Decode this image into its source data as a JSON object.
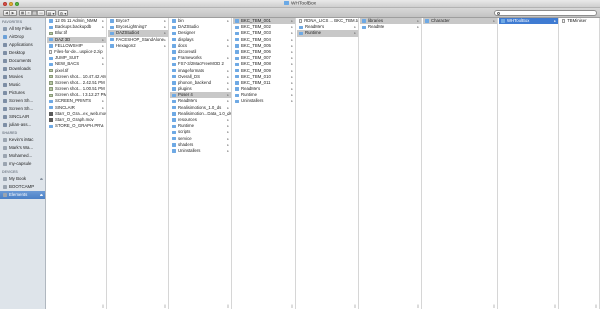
{
  "window": {
    "title": "WHToolBox"
  },
  "toolbar": {
    "back_label": "◀",
    "forward_label": "▶",
    "view_modes": [
      "▦",
      "≡",
      "▥",
      "▭"
    ],
    "arrange_label": "▤ ▾",
    "action_label": "⚙ ▾",
    "search_placeholder": ""
  },
  "sidebar": {
    "favorites_heading": "FAVORITES",
    "favorites": [
      {
        "label": "All My Files",
        "icon": "all-files-icon",
        "color": "#8a9bb0"
      },
      {
        "label": "AirDrop",
        "icon": "airdrop-icon",
        "color": "#6aa0d8"
      },
      {
        "label": "Applications",
        "icon": "applications-icon",
        "color": "#7d8ea5"
      },
      {
        "label": "Desktop",
        "icon": "desktop-icon",
        "color": "#7d8ea5"
      },
      {
        "label": "Documents",
        "icon": "documents-icon",
        "color": "#7d8ea5"
      },
      {
        "label": "Downloads",
        "icon": "downloads-icon",
        "color": "#7d8ea5"
      },
      {
        "label": "Movies",
        "icon": "movies-icon",
        "color": "#7d8ea5"
      },
      {
        "label": "Music",
        "icon": "music-icon",
        "color": "#7d8ea5"
      },
      {
        "label": "Pictures",
        "icon": "pictures-icon",
        "color": "#7d8ea5"
      },
      {
        "label": "Screen Sh...",
        "icon": "folder-icon",
        "color": "#7d8ea5"
      },
      {
        "label": "Screen Sh...",
        "icon": "folder-icon",
        "color": "#7d8ea5"
      },
      {
        "label": "SINCLAIR",
        "icon": "folder-icon",
        "color": "#7d8ea5"
      },
      {
        "label": "julian-ass...",
        "icon": "folder-icon",
        "color": "#7d8ea5"
      }
    ],
    "shared_heading": "SHARED",
    "shared": [
      {
        "label": "Kevin's iMac",
        "icon": "imac-icon",
        "color": "#9aa4b0"
      },
      {
        "label": "Mark's Wa...",
        "icon": "computer-icon",
        "color": "#9aa4b0"
      },
      {
        "label": "Mohamed...",
        "icon": "computer-icon",
        "color": "#9aa4b0"
      },
      {
        "label": "my-capsule",
        "icon": "time-capsule-icon",
        "color": "#9aa4b0"
      }
    ],
    "devices_heading": "DEVICES",
    "devices": [
      {
        "label": "My Book",
        "icon": "external-drive-icon",
        "color": "#9aa4b0",
        "eject": "⏏",
        "selected": false
      },
      {
        "label": "BOOTCAMP",
        "icon": "internal-drive-icon",
        "color": "#9aa4b0",
        "eject": "",
        "selected": false
      },
      {
        "label": "Elements",
        "icon": "external-drive-icon",
        "color": "#9aa4b0",
        "eject": "⏏",
        "selected": true
      }
    ]
  },
  "columns": [
    {
      "items": [
        {
          "label": "12 05 11 Admin_NMM",
          "kind": "folder",
          "arrow": "▸",
          "state": ""
        },
        {
          "label": "Backups.backupdb",
          "kind": "folder",
          "arrow": "▸",
          "state": ""
        },
        {
          "label": "Blur.tif",
          "kind": "img",
          "arrow": "",
          "state": ""
        },
        {
          "label": "DAZ 3D",
          "kind": "folder",
          "arrow": "▸",
          "state": "sel"
        },
        {
          "label": "FELLOWSHIP",
          "kind": "folder",
          "arrow": "▸",
          "state": ""
        },
        {
          "label": "Files-for-de...uspiior-2.zip",
          "kind": "file",
          "arrow": "",
          "state": ""
        },
        {
          "label": "JUMP_SUIT",
          "kind": "folder",
          "arrow": "▸",
          "state": ""
        },
        {
          "label": "NEW_BACS",
          "kind": "folder",
          "arrow": "▸",
          "state": ""
        },
        {
          "label": "pixel.tif",
          "kind": "img",
          "arrow": "",
          "state": ""
        },
        {
          "label": "Screen shot... 10.47.42 AM",
          "kind": "img",
          "arrow": "",
          "state": ""
        },
        {
          "label": "Screen shot... 2.42.51 PM",
          "kind": "img",
          "arrow": "",
          "state": ""
        },
        {
          "label": "Screen shot... 1.00.51 PM",
          "kind": "img",
          "arrow": "",
          "state": ""
        },
        {
          "label": "Screen shot... t 3.12.27 PM",
          "kind": "img",
          "arrow": "",
          "state": ""
        },
        {
          "label": "SCREEN_PRINTS",
          "kind": "folder",
          "arrow": "▸",
          "state": ""
        },
        {
          "label": "SINCLAIR",
          "kind": "folder",
          "arrow": "▸",
          "state": ""
        },
        {
          "label": "Starr_O_Gra...ex_web.mov",
          "kind": "mov",
          "arrow": "",
          "state": ""
        },
        {
          "label": "Starr_O_Graph.mov",
          "kind": "mov",
          "arrow": "",
          "state": ""
        },
        {
          "label": "STORE_O_GRAPH.PRV",
          "kind": "folder",
          "arrow": "▸",
          "state": ""
        }
      ]
    },
    {
      "items": [
        {
          "label": "Bryce7",
          "kind": "folder",
          "arrow": "▸",
          "state": ""
        },
        {
          "label": "BryceLightning7",
          "kind": "folder",
          "arrow": "▸",
          "state": ""
        },
        {
          "label": "DAZStudio4",
          "kind": "folder",
          "arrow": "▸",
          "state": "sel"
        },
        {
          "label": "FACESHOP_StandAlone",
          "kind": "folder",
          "arrow": "▸",
          "state": ""
        },
        {
          "label": "Hexagon2",
          "kind": "folder",
          "arrow": "▸",
          "state": ""
        }
      ]
    },
    {
      "items": [
        {
          "label": "bin",
          "kind": "folder",
          "arrow": "▸",
          "state": ""
        },
        {
          "label": "DAZStudio",
          "kind": "folder",
          "arrow": "",
          "state": ""
        },
        {
          "label": "Designer",
          "kind": "folder",
          "arrow": "",
          "state": ""
        },
        {
          "label": "displays",
          "kind": "folder",
          "arrow": "▸",
          "state": ""
        },
        {
          "label": "docs",
          "kind": "folder",
          "arrow": "▸",
          "state": ""
        },
        {
          "label": "dzcoreutil",
          "kind": "folder",
          "arrow": "",
          "state": ""
        },
        {
          "label": "Frameworks",
          "kind": "folder",
          "arrow": "▸",
          "state": ""
        },
        {
          "label": "FS7-3/2MacFreeMOD 2",
          "kind": "folder",
          "arrow": "",
          "state": ""
        },
        {
          "label": "imageformats",
          "kind": "folder",
          "arrow": "▸",
          "state": ""
        },
        {
          "label": "Overall_DS",
          "kind": "folder",
          "arrow": "▸",
          "state": ""
        },
        {
          "label": "phonon_backend",
          "kind": "folder",
          "arrow": "▸",
          "state": ""
        },
        {
          "label": "plugins",
          "kind": "folder",
          "arrow": "▸",
          "state": ""
        },
        {
          "label": "Poser 4",
          "kind": "folder",
          "arrow": "▸",
          "state": "sel"
        },
        {
          "label": "ReadMe's",
          "kind": "folder",
          "arrow": "▸",
          "state": ""
        },
        {
          "label": "Realisimotions_1.0_ds",
          "kind": "folder",
          "arrow": "▸",
          "state": ""
        },
        {
          "label": "Realisimotion...Data_1.0_ds",
          "kind": "folder",
          "arrow": "▸",
          "state": ""
        },
        {
          "label": "resources",
          "kind": "folder",
          "arrow": "▸",
          "state": ""
        },
        {
          "label": "Runtime",
          "kind": "folder",
          "arrow": "▸",
          "state": ""
        },
        {
          "label": "scripts",
          "kind": "folder",
          "arrow": "▸",
          "state": ""
        },
        {
          "label": "service",
          "kind": "folder",
          "arrow": "▸",
          "state": ""
        },
        {
          "label": "shaders",
          "kind": "folder",
          "arrow": "▸",
          "state": ""
        },
        {
          "label": "Uninstallers",
          "kind": "folder",
          "arrow": "▸",
          "state": ""
        }
      ]
    },
    {
      "items": [
        {
          "label": "BKC_TBM_001",
          "kind": "folder",
          "arrow": "▸",
          "state": "sel"
        },
        {
          "label": "BKC_TBM_002",
          "kind": "folder",
          "arrow": "▸",
          "state": ""
        },
        {
          "label": "BKC_TBM_003",
          "kind": "folder",
          "arrow": "▸",
          "state": ""
        },
        {
          "label": "BKC_TBM_004",
          "kind": "folder",
          "arrow": "▸",
          "state": ""
        },
        {
          "label": "BKC_TBM_005",
          "kind": "folder",
          "arrow": "▸",
          "state": ""
        },
        {
          "label": "BKC_TBM_006",
          "kind": "folder",
          "arrow": "▸",
          "state": ""
        },
        {
          "label": "BKC_TBM_007",
          "kind": "folder",
          "arrow": "▸",
          "state": ""
        },
        {
          "label": "BKC_TBM_008",
          "kind": "folder",
          "arrow": "▸",
          "state": ""
        },
        {
          "label": "BKC_TBM_009",
          "kind": "folder",
          "arrow": "▸",
          "state": ""
        },
        {
          "label": "BKC_TBM_010",
          "kind": "folder",
          "arrow": "▸",
          "state": ""
        },
        {
          "label": "BKC_TBM_011",
          "kind": "folder",
          "arrow": "▸",
          "state": ""
        },
        {
          "label": "ReadMe's",
          "kind": "folder",
          "arrow": "▸",
          "state": ""
        },
        {
          "label": "Runtime",
          "kind": "folder",
          "arrow": "▸",
          "state": ""
        },
        {
          "label": "Uninstallers",
          "kind": "folder",
          "arrow": "▸",
          "state": ""
        }
      ]
    },
    {
      "items": [
        {
          "label": "RDNA_LICS ... BKC_TBM.txt",
          "kind": "file",
          "arrow": "",
          "state": ""
        },
        {
          "label": "ReadMe's",
          "kind": "folder",
          "arrow": "▸",
          "state": ""
        },
        {
          "label": "Runtime",
          "kind": "folder",
          "arrow": "▸",
          "state": "sel"
        }
      ]
    },
    {
      "items": [
        {
          "label": "libraries",
          "kind": "folder",
          "arrow": "▸",
          "state": "sel"
        },
        {
          "label": "ReadMe",
          "kind": "folder",
          "arrow": "▸",
          "state": ""
        }
      ]
    },
    {
      "items": [
        {
          "label": "Character",
          "kind": "folder",
          "arrow": "▸",
          "state": "sel"
        }
      ]
    },
    {
      "items": [
        {
          "label": "WHToolBox",
          "kind": "folder",
          "arrow": "▸",
          "state": "selactive"
        }
      ]
    },
    {
      "items": [
        {
          "label": "TBMiniser",
          "kind": "file",
          "arrow": "",
          "state": ""
        }
      ]
    }
  ]
}
